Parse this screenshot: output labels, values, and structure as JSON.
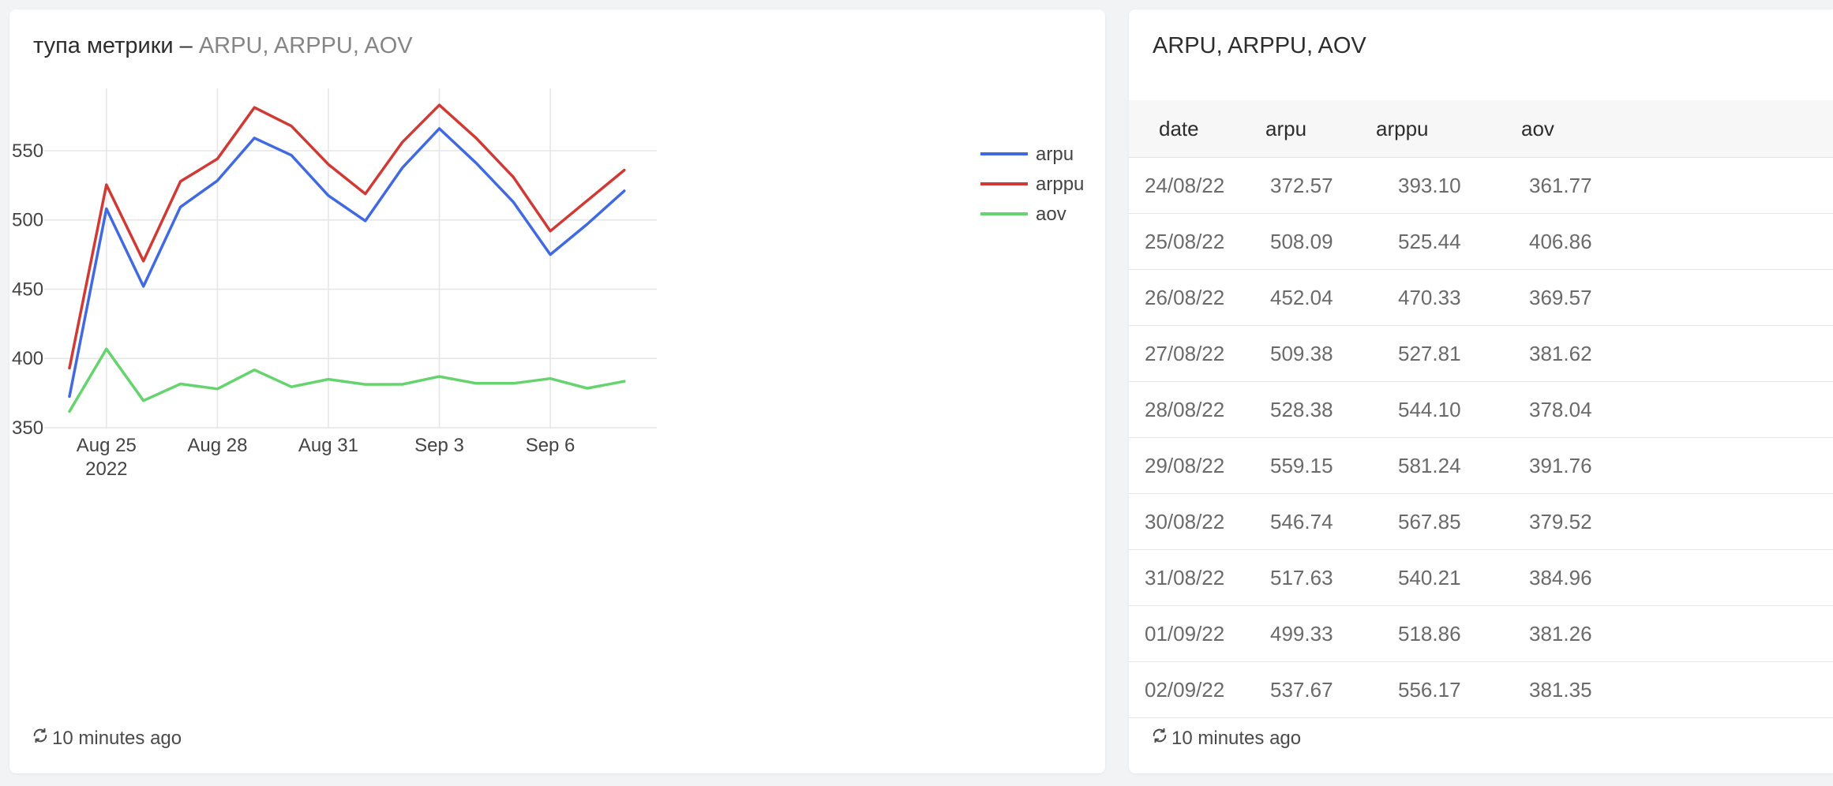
{
  "chart_card": {
    "title_prefix": "тупа метрики – ",
    "title_suffix": "ARPU, ARPPU, AOV",
    "footer": "10 minutes ago"
  },
  "table_card": {
    "title": "ARPU, ARPPU, AOV",
    "columns": [
      "date",
      "arpu",
      "arppu",
      "aov"
    ],
    "rows": [
      [
        "24/08/22",
        "372.57",
        "393.10",
        "361.77"
      ],
      [
        "25/08/22",
        "508.09",
        "525.44",
        "406.86"
      ],
      [
        "26/08/22",
        "452.04",
        "470.33",
        "369.57"
      ],
      [
        "27/08/22",
        "509.38",
        "527.81",
        "381.62"
      ],
      [
        "28/08/22",
        "528.38",
        "544.10",
        "378.04"
      ],
      [
        "29/08/22",
        "559.15",
        "581.24",
        "391.76"
      ],
      [
        "30/08/22",
        "546.74",
        "567.85",
        "379.52"
      ],
      [
        "31/08/22",
        "517.63",
        "540.21",
        "384.96"
      ],
      [
        "01/09/22",
        "499.33",
        "518.86",
        "381.26"
      ],
      [
        "02/09/22",
        "537.67",
        "556.17",
        "381.35"
      ]
    ],
    "footer": "10 minutes ago"
  },
  "chart_data": {
    "type": "line",
    "x": [
      "2022-08-24",
      "2022-08-25",
      "2022-08-26",
      "2022-08-27",
      "2022-08-28",
      "2022-08-29",
      "2022-08-30",
      "2022-08-31",
      "2022-09-01",
      "2022-09-02",
      "2022-09-03",
      "2022-09-04",
      "2022-09-05",
      "2022-09-06",
      "2022-09-07",
      "2022-09-08"
    ],
    "x_ticks": [
      {
        "date": "2022-08-25",
        "label": "Aug 25",
        "sublabel": "2022"
      },
      {
        "date": "2022-08-28",
        "label": "Aug 28",
        "sublabel": ""
      },
      {
        "date": "2022-08-31",
        "label": "Aug 31",
        "sublabel": ""
      },
      {
        "date": "2022-09-03",
        "label": "Sep 3",
        "sublabel": ""
      },
      {
        "date": "2022-09-06",
        "label": "Sep 6",
        "sublabel": ""
      }
    ],
    "y_ticks": [
      350,
      400,
      450,
      500,
      550
    ],
    "ylim": [
      350,
      595
    ],
    "grid": true,
    "legend_position": "top-right",
    "series": [
      {
        "name": "arpu",
        "color": "#4169e1",
        "values": [
          372.57,
          508.09,
          452.04,
          509.38,
          528.38,
          559.15,
          546.74,
          517.63,
          499.33,
          537.67,
          566,
          541,
          513,
          475,
          497,
          521
        ]
      },
      {
        "name": "arppu",
        "color": "#d13a34",
        "values": [
          393.1,
          525.44,
          470.33,
          527.81,
          544.1,
          581.24,
          567.85,
          540.21,
          518.86,
          556.17,
          583,
          559,
          531,
          492,
          514,
          536
        ]
      },
      {
        "name": "aov",
        "color": "#66d46e",
        "values": [
          361.77,
          406.86,
          369.57,
          381.62,
          378.04,
          391.76,
          379.52,
          384.96,
          381.26,
          381.35,
          387,
          382,
          382,
          385.5,
          378.5,
          383.5
        ]
      }
    ]
  }
}
